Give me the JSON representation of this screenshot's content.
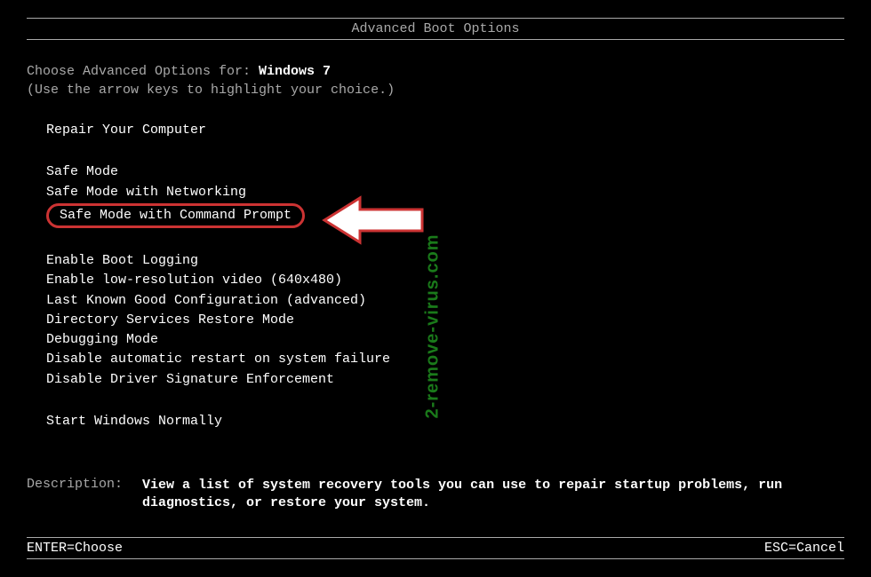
{
  "title": "Advanced Boot Options",
  "prompt": {
    "prefix": "Choose Advanced Options for: ",
    "os": "Windows 7",
    "hint": "(Use the arrow keys to highlight your choice.)"
  },
  "group1": [
    "Repair Your Computer"
  ],
  "group2": [
    "Safe Mode",
    "Safe Mode with Networking",
    "Safe Mode with Command Prompt"
  ],
  "group3": [
    "Enable Boot Logging",
    "Enable low-resolution video (640x480)",
    "Last Known Good Configuration (advanced)",
    "Directory Services Restore Mode",
    "Debugging Mode",
    "Disable automatic restart on system failure",
    "Disable Driver Signature Enforcement"
  ],
  "group4": [
    "Start Windows Normally"
  ],
  "description": {
    "label": "Description:",
    "text": "View a list of system recovery tools you can use to repair startup problems, run diagnostics, or restore your system."
  },
  "footer": {
    "left": "ENTER=Choose",
    "right": "ESC=Cancel"
  },
  "watermark": "2-remove-virus.com"
}
